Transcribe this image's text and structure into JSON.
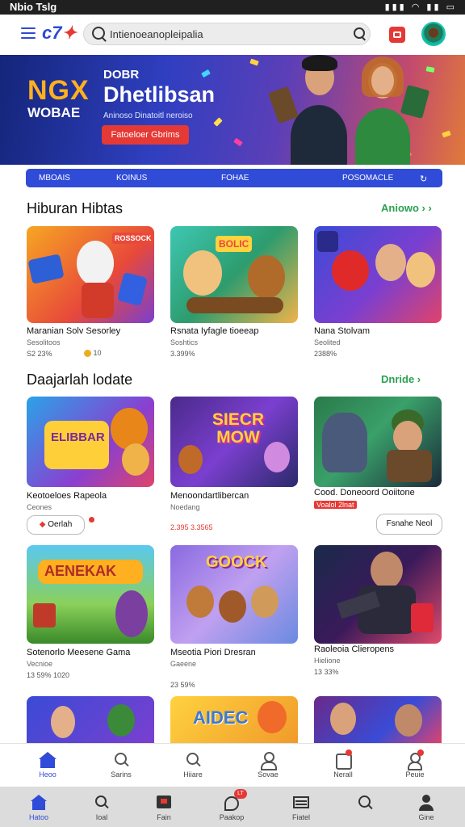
{
  "status_bar": {
    "time": "Nbio Tslg",
    "icons": "▮▮▮ ◠ ▮▮ ▭"
  },
  "header": {
    "logo": "c7",
    "search": {
      "value": "Intienoeanopleipalia"
    }
  },
  "banner": {
    "logo_main": "NGX",
    "logo_sub": "WOBAE",
    "kicker": "DOBR",
    "title": "Dhetlibsan",
    "subtitle": "Aninoso Dinatoitl neroiso",
    "button_label": "Fatoeloer Gbrims"
  },
  "tab_strip": {
    "items": [
      "MBOAIS",
      "KOINUS",
      "FOHAE",
      "POSOMACLE"
    ]
  },
  "sections": [
    {
      "title": "Hiburan Hibtas",
      "more_label": "Aniowo",
      "cards": [
        {
          "title": "Maranian Solv Sesorley",
          "sub": "Sesolitoos",
          "meta": "S2 23%",
          "meta2": "10"
        },
        {
          "title": "Rsnata Iyfagle tioeeap",
          "sub": "Soshtics",
          "meta": "3.399%"
        },
        {
          "title": "Nana Stolvam",
          "sub": "Seolited",
          "meta": "2388%"
        }
      ]
    },
    {
      "title": "Daajarlah lodate",
      "more_label": "Dnride",
      "cards": [
        {
          "title": "Keotoeloes Rapeola",
          "sub": "Ceones",
          "pill": "Oerlah"
        },
        {
          "title": "Menoondartlibercan",
          "sub": "Noedang",
          "meta": "2.395 3.3565"
        },
        {
          "title": "Cood. Doneoord Ooiitone",
          "sub": "Voalol 2lnat",
          "pill": "Fsnahe Neol"
        }
      ]
    },
    {
      "title": "",
      "more_label": "",
      "cards": [
        {
          "title": "Sotenorlo Meesene Gama",
          "sub": "Vecnioe",
          "meta": "13 59% 1020"
        },
        {
          "title": "Mseotia Piori Dresran",
          "sub": "Gaeene",
          "meta": "23 59%"
        },
        {
          "title": "Raoleoia Clieropens",
          "sub": "Hielione",
          "meta": "13 33%"
        }
      ]
    }
  ],
  "card_art": [
    {
      "label": "ROSSOCK"
    },
    {
      "label": "BOLIC"
    },
    {
      "label": ""
    },
    {
      "label": "ELIBBAR"
    },
    {
      "label": "SIECR MOW"
    },
    {
      "label": ""
    },
    {
      "label": "AENEKAK"
    },
    {
      "label": "GOOCK"
    },
    {
      "label": ""
    },
    {
      "label": ""
    },
    {
      "label": "AIDEC"
    },
    {
      "label": ""
    }
  ],
  "bottom_nav_primary": [
    {
      "label": "Heoo",
      "icon": "home-icon",
      "active": true
    },
    {
      "label": "Sarins",
      "icon": "search-icon"
    },
    {
      "label": "Hiiare",
      "icon": "magnifier-icon"
    },
    {
      "label": "Sovae",
      "icon": "profile-icon"
    },
    {
      "label": "Nerall",
      "icon": "notification-icon",
      "badge": ""
    },
    {
      "label": "Peuie",
      "icon": "people-icon",
      "badge": ""
    }
  ],
  "bottom_nav_secondary": [
    {
      "label": "Hatoo",
      "icon": "home-icon",
      "active": true
    },
    {
      "label": "Ioal",
      "icon": "search-icon"
    },
    {
      "label": "Fain",
      "icon": "game-icon"
    },
    {
      "label": "Paakop",
      "icon": "shop-icon",
      "badge": "LT"
    },
    {
      "label": "Fiatel",
      "icon": "list-icon"
    },
    {
      "label": "",
      "icon": "explore-icon"
    },
    {
      "label": "Gine",
      "icon": "user-icon"
    }
  ],
  "colors": {
    "accent": "#2f4bd8",
    "brand_red": "#e53935",
    "link_green": "#2aa150"
  }
}
